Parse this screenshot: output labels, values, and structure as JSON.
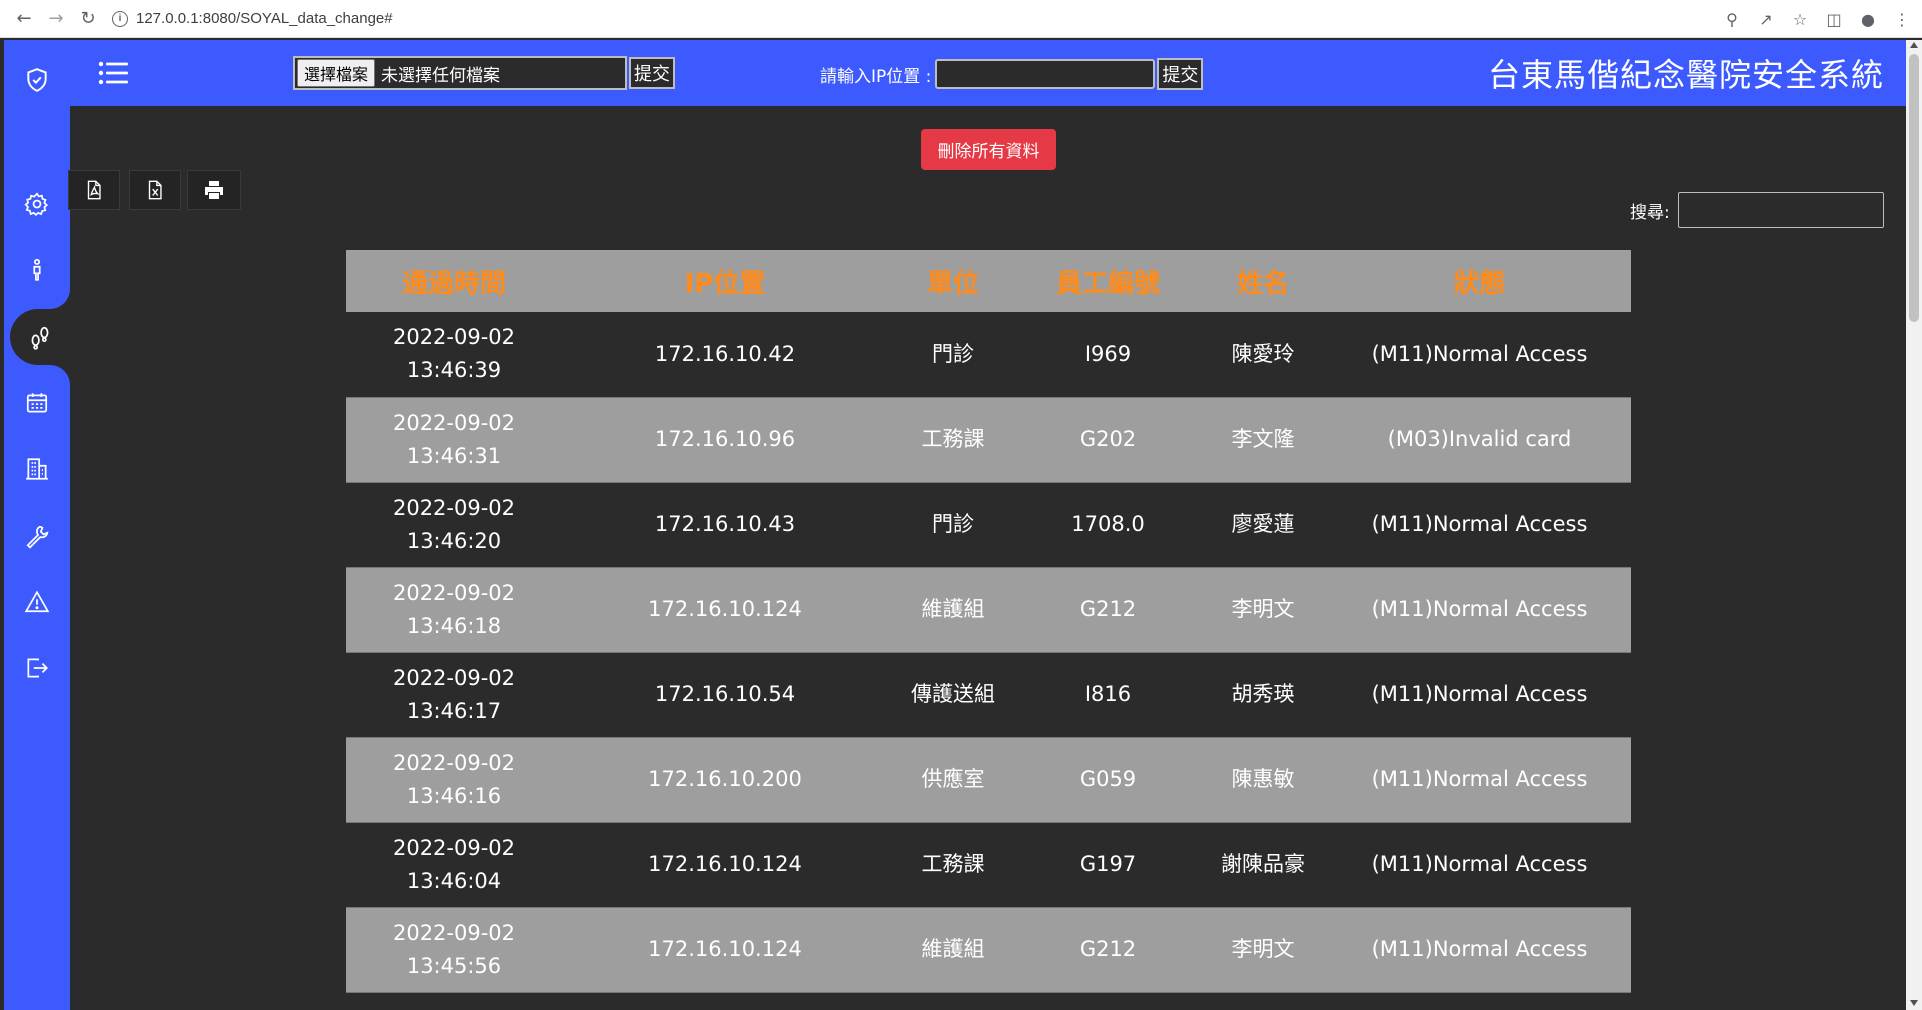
{
  "browser": {
    "url": "127.0.0.1:8080/SOYAL_data_change#"
  },
  "header": {
    "file_choose_label": "選擇檔案",
    "file_status": "未選擇任何檔案",
    "file_submit_label": "提交",
    "ip_label": "請輸入IP位置 :",
    "ip_submit_label": "提交",
    "title": "台東馬偕紀念醫院安全系統"
  },
  "sidebar": {
    "items": [
      {
        "icon": "gear-icon"
      },
      {
        "icon": "person-icon"
      },
      {
        "icon": "footprints-icon",
        "active": true
      },
      {
        "icon": "calendar-icon"
      },
      {
        "icon": "building-icon"
      },
      {
        "icon": "wrench-icon"
      },
      {
        "icon": "warning-icon"
      },
      {
        "icon": "logout-icon"
      }
    ]
  },
  "toolbar": {
    "delete_all_label": "刪除所有資料",
    "search_label": "搜尋:"
  },
  "table": {
    "headers": [
      "通過時間",
      "IP位置",
      "單位",
      "員工編號",
      "姓名",
      "狀態"
    ],
    "rows": [
      {
        "date": "2022-09-02",
        "time": "13:46:39",
        "ip": "172.16.10.42",
        "unit": "門診",
        "emp": "I969",
        "name": "陳愛玲",
        "status": "(M11)Normal Access"
      },
      {
        "date": "2022-09-02",
        "time": "13:46:31",
        "ip": "172.16.10.96",
        "unit": "工務課",
        "emp": "G202",
        "name": "李文隆",
        "status": "(M03)Invalid card"
      },
      {
        "date": "2022-09-02",
        "time": "13:46:20",
        "ip": "172.16.10.43",
        "unit": "門診",
        "emp": "1708.0",
        "name": "廖愛蓮",
        "status": "(M11)Normal Access"
      },
      {
        "date": "2022-09-02",
        "time": "13:46:18",
        "ip": "172.16.10.124",
        "unit": "維護組",
        "emp": "G212",
        "name": "李明文",
        "status": "(M11)Normal Access"
      },
      {
        "date": "2022-09-02",
        "time": "13:46:17",
        "ip": "172.16.10.54",
        "unit": "傳護送組",
        "emp": "I816",
        "name": "胡秀瑛",
        "status": "(M11)Normal Access"
      },
      {
        "date": "2022-09-02",
        "time": "13:46:16",
        "ip": "172.16.10.200",
        "unit": "供應室",
        "emp": "G059",
        "name": "陳惠敏",
        "status": "(M11)Normal Access"
      },
      {
        "date": "2022-09-02",
        "time": "13:46:04",
        "ip": "172.16.10.124",
        "unit": "工務課",
        "emp": "G197",
        "name": "謝陳品豪",
        "status": "(M11)Normal Access"
      },
      {
        "date": "2022-09-02",
        "time": "13:45:56",
        "ip": "172.16.10.124",
        "unit": "維護組",
        "emp": "G212",
        "name": "李明文",
        "status": "(M11)Normal Access"
      }
    ]
  },
  "colors": {
    "primary": "#3d5afe",
    "background": "#2b2b2b",
    "header_text": "#ff8c1a",
    "danger": "#e53945",
    "stripe": "#9e9e9e"
  }
}
